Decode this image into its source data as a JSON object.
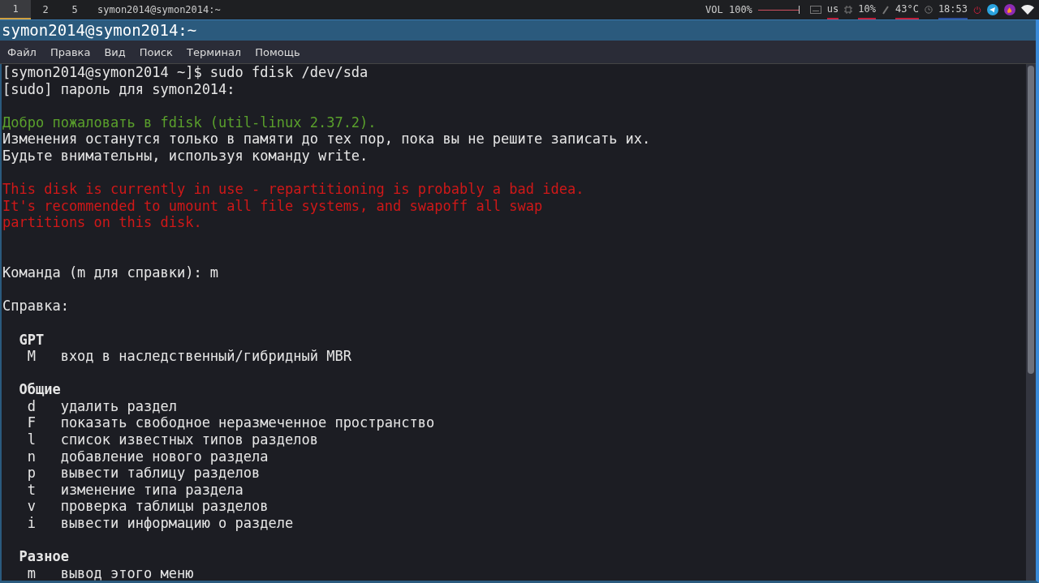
{
  "panel": {
    "workspaces": [
      {
        "label": "1",
        "selected": true
      },
      {
        "label": "2",
        "selected": false
      },
      {
        "label": "5",
        "selected": false
      }
    ],
    "active_title": "symon2014@symon2014:~",
    "volume": {
      "label": "VOL 100%",
      "level": 1
    },
    "keyboard": "us",
    "cpu": "10%",
    "temperature": "43°C",
    "clock": "18:53"
  },
  "window": {
    "title": "symon2014@symon2014:~"
  },
  "menu": [
    "Файл",
    "Правка",
    "Вид",
    "Поиск",
    "Терминал",
    "Помощь"
  ],
  "terminal": {
    "lines": [
      {
        "kind": "normal",
        "text": "[symon2014@symon2014 ~]$ sudo fdisk /dev/sda"
      },
      {
        "kind": "normal",
        "text": "[sudo] пароль для symon2014:"
      },
      {
        "kind": "blank"
      },
      {
        "kind": "green",
        "text": "Добро пожаловать в fdisk (util-linux 2.37.2)."
      },
      {
        "kind": "normal",
        "text": "Изменения останутся только в памяти до тех пор, пока вы не решите записать их."
      },
      {
        "kind": "normal",
        "text": "Будьте внимательны, используя команду write."
      },
      {
        "kind": "blank"
      },
      {
        "kind": "red",
        "text": "This disk is currently in use - repartitioning is probably a bad idea."
      },
      {
        "kind": "red",
        "text": "It's recommended to umount all file systems, and swapoff all swap"
      },
      {
        "kind": "red",
        "text": "partitions on this disk."
      },
      {
        "kind": "blank"
      },
      {
        "kind": "blank"
      },
      {
        "kind": "normal",
        "text": "Команда (m для справки): m"
      },
      {
        "kind": "blank"
      },
      {
        "kind": "normal",
        "text": "Справка:"
      },
      {
        "kind": "blank"
      },
      {
        "kind": "header",
        "text": "GPT"
      },
      {
        "kind": "option",
        "key": "M",
        "text": "вход в наследственный/гибридный MBR"
      },
      {
        "kind": "blank"
      },
      {
        "kind": "header",
        "text": "Общие"
      },
      {
        "kind": "option",
        "key": "d",
        "text": "удалить раздел"
      },
      {
        "kind": "option",
        "key": "F",
        "text": "показать свободное неразмеченное пространство"
      },
      {
        "kind": "option",
        "key": "l",
        "text": "список известных типов разделов"
      },
      {
        "kind": "option",
        "key": "n",
        "text": "добавление нового раздела"
      },
      {
        "kind": "option",
        "key": "p",
        "text": "вывести таблицу разделов"
      },
      {
        "kind": "option",
        "key": "t",
        "text": "изменение типа раздела"
      },
      {
        "kind": "option",
        "key": "v",
        "text": "проверка таблицы разделов"
      },
      {
        "kind": "option",
        "key": "i",
        "text": "вывести информацию о разделе"
      },
      {
        "kind": "blank"
      },
      {
        "kind": "header",
        "text": "Разное"
      },
      {
        "kind": "option",
        "key": "m",
        "text": "вывод этого меню"
      }
    ]
  }
}
